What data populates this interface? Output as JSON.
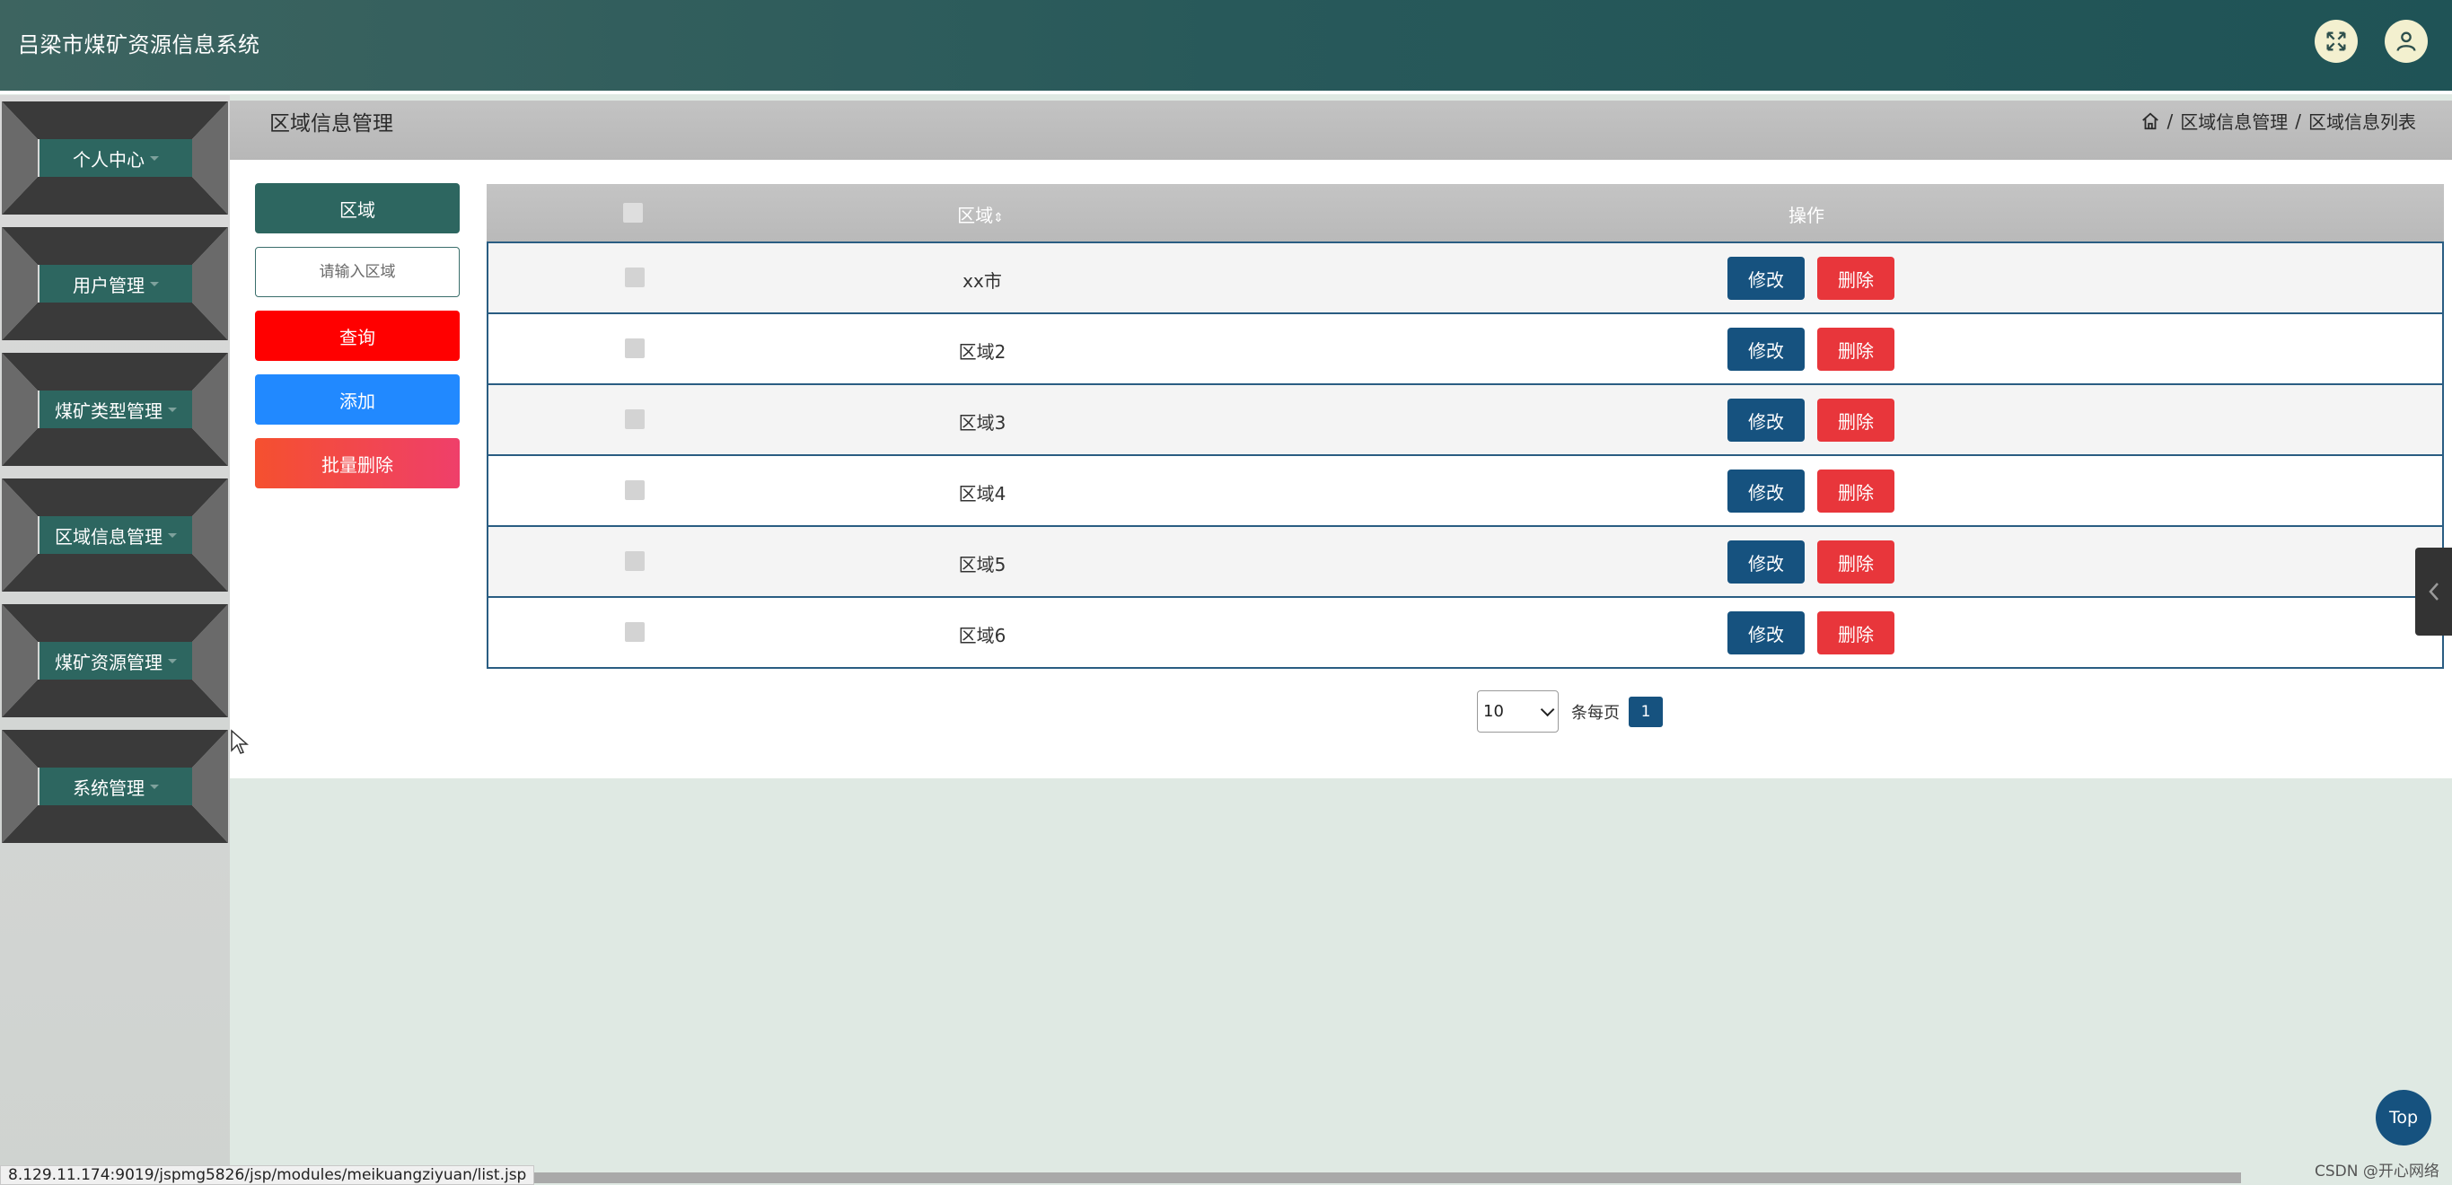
{
  "header": {
    "title": "吕梁市煤矿资源信息系统",
    "fullscreen_icon": "fullscreen-icon",
    "user_icon": "user-icon"
  },
  "sidebar": {
    "items": [
      {
        "label": "个人中心"
      },
      {
        "label": "用户管理"
      },
      {
        "label": "煤矿类型管理"
      },
      {
        "label": "区域信息管理"
      },
      {
        "label": "煤矿资源管理"
      },
      {
        "label": "系统管理"
      }
    ]
  },
  "breadcrumb": {
    "title": "区域信息管理",
    "path": [
      "区域信息管理",
      "区域信息列表"
    ],
    "separator": "/"
  },
  "search": {
    "field_label": "区域",
    "placeholder": "请输入区域",
    "value": "",
    "query_label": "查询",
    "add_label": "添加",
    "batch_delete_label": "批量删除"
  },
  "table": {
    "headers": {
      "area": "区域",
      "sort_icon": "⇕",
      "ops": "操作"
    },
    "rows": [
      {
        "area": "xx市"
      },
      {
        "area": "区域2"
      },
      {
        "area": "区域3"
      },
      {
        "area": "区域4"
      },
      {
        "area": "区域5"
      },
      {
        "area": "区域6"
      }
    ],
    "edit_label": "修改",
    "delete_label": "删除"
  },
  "pagination": {
    "page_size": "10",
    "per_page_text": "条每页",
    "current_page": "1"
  },
  "top_button": "Top",
  "status_url": "8.129.11.174:9019/jspmg5826/jsp/modules/meikuangziyuan/list.jsp",
  "watermark": "CSDN @开心网络",
  "colors": {
    "header": "#28595a",
    "menu_label": "#2d6660",
    "primary": "#16527f",
    "danger": "#e8363b",
    "query": "#ff0000",
    "add": "#2189ff",
    "batch_delete": "#f24d3e"
  }
}
